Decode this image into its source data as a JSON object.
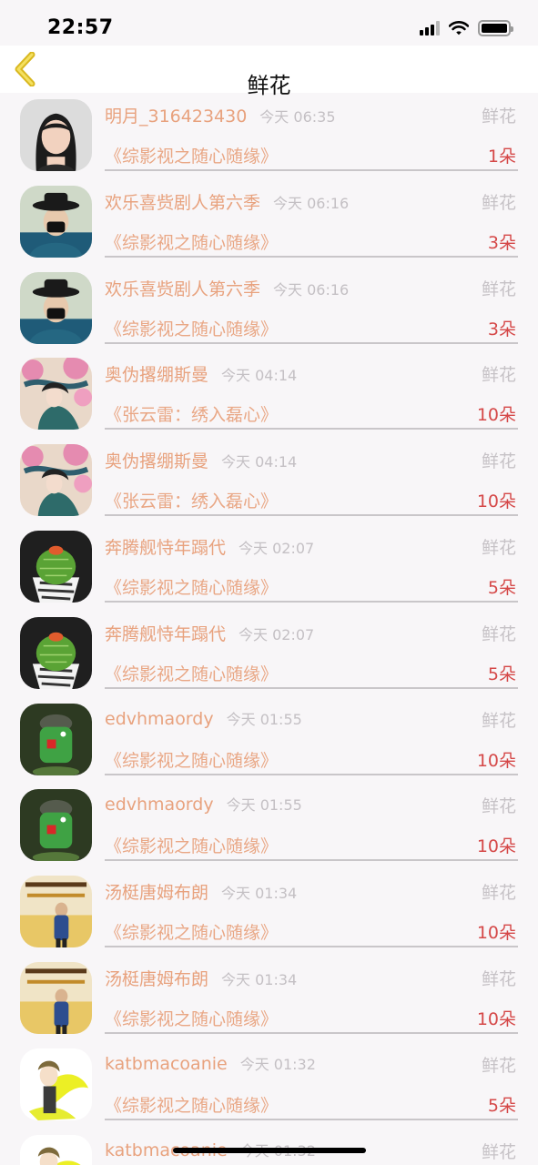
{
  "status_bar": {
    "time": "22:57",
    "signal_icon": "cellular-signal-icon",
    "wifi_icon": "wifi-icon",
    "battery_icon": "battery-icon"
  },
  "nav": {
    "title": "鲜花",
    "back_icon": "chevron-left-icon",
    "accent_color": "#e6c619"
  },
  "records": [
    {
      "avatar": "girl-portrait",
      "name": "明月_316423430",
      "time": "今天 06:35",
      "gift": "鲜花",
      "book": "《综影视之随心随缘》",
      "count": "1朵"
    },
    {
      "avatar": "masked-man-hat",
      "name": "欢乐喜赀剧人第六季",
      "time": "今天 06:16",
      "gift": "鲜花",
      "book": "《综影视之随心随缘》",
      "count": "3朵"
    },
    {
      "avatar": "masked-man-hat",
      "name": "欢乐喜赀剧人第六季",
      "time": "今天 06:16",
      "gift": "鲜花",
      "book": "《综影视之随心随缘》",
      "count": "3朵"
    },
    {
      "avatar": "anime-blossom",
      "name": "奥伪撂绷斯曼",
      "time": "今天 04:14",
      "gift": "鲜花",
      "book": "《张云雷：绣入磊心》",
      "count": "10朵"
    },
    {
      "avatar": "anime-blossom",
      "name": "奥伪撂绷斯曼",
      "time": "今天 04:14",
      "gift": "鲜花",
      "book": "《张云雷：绣入磊心》",
      "count": "10朵"
    },
    {
      "avatar": "cactus-pot",
      "name": "奔腾舰恃年蹋代",
      "time": "今天 02:07",
      "gift": "鲜花",
      "book": "《综影视之随心随缘》",
      "count": "5朵"
    },
    {
      "avatar": "cactus-pot",
      "name": "奔腾舰恃年蹋代",
      "time": "今天 02:07",
      "gift": "鲜花",
      "book": "《综影视之随心随缘》",
      "count": "5朵"
    },
    {
      "avatar": "green-toy-soldier",
      "name": "edvhmaordy",
      "time": "今天 01:55",
      "gift": "鲜花",
      "book": "《综影视之随心随缘》",
      "count": "10朵"
    },
    {
      "avatar": "green-toy-soldier",
      "name": "edvhmaordy",
      "time": "今天 01:55",
      "gift": "鲜花",
      "book": "《综影视之随心随缘》",
      "count": "10朵"
    },
    {
      "avatar": "poster-person",
      "name": "汤梃唐姆布朗",
      "time": "今天 01:34",
      "gift": "鲜花",
      "book": "《综影视之随心随缘》",
      "count": "10朵"
    },
    {
      "avatar": "poster-person",
      "name": "汤梃唐姆布朗",
      "time": "今天 01:34",
      "gift": "鲜花",
      "book": "《综影视之随心随缘》",
      "count": "10朵"
    },
    {
      "avatar": "anime-boy-yellow",
      "name": "katbmacoanie",
      "time": "今天 01:32",
      "gift": "鲜花",
      "book": "《综影视之随心随缘》",
      "count": "5朵"
    },
    {
      "avatar": "anime-boy-yellow",
      "name": "katbmacoanie",
      "time": "今天 01:32",
      "gift": "鲜花",
      "book": "",
      "count": ""
    }
  ]
}
